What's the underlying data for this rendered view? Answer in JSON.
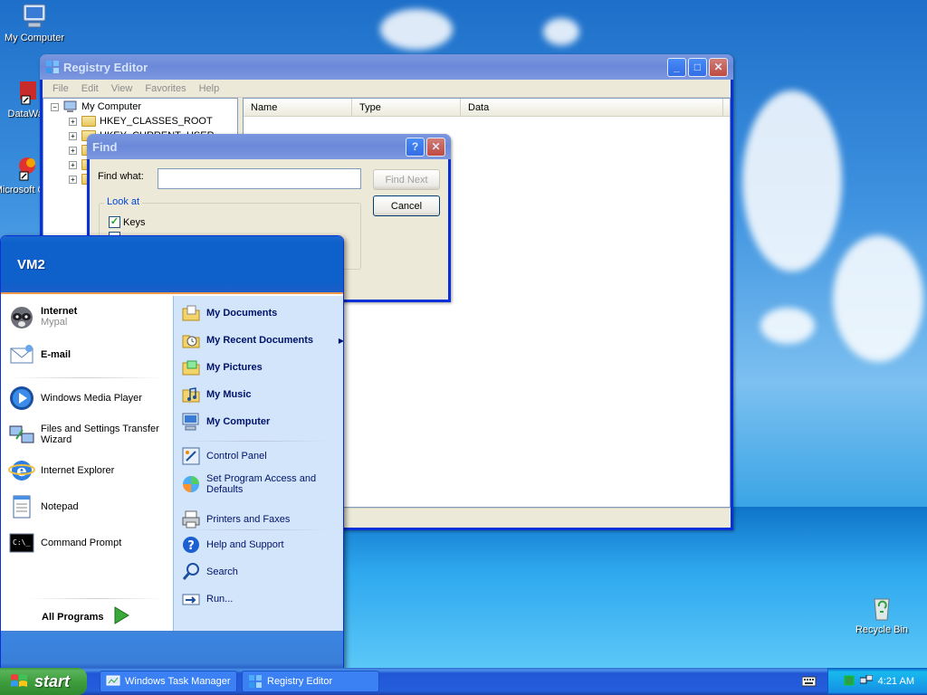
{
  "desktop": {
    "icons": [
      {
        "label": "My Computer"
      },
      {
        "label": "DataWar"
      },
      {
        "label": "Microsoft C++"
      },
      {
        "label": "Recycle Bin"
      }
    ]
  },
  "registry_editor": {
    "title": "Registry Editor",
    "menu": [
      "File",
      "Edit",
      "View",
      "Favorites",
      "Help"
    ],
    "tree_root": "My Computer",
    "tree_items": [
      "HKEY_CLASSES_ROOT",
      "HKEY_CURRENT_USER",
      "",
      "",
      ""
    ],
    "columns": [
      "Name",
      "Type",
      "Data"
    ]
  },
  "find_dialog": {
    "title": "Find",
    "find_what_label": "Find what:",
    "find_what_value": "",
    "find_next_label": "Find Next",
    "cancel_label": "Cancel",
    "look_at_label": "Look at",
    "keys_label": "Keys"
  },
  "start_menu": {
    "user_name": "VM2",
    "pinned": [
      {
        "title": "Internet",
        "subtitle": "Mypal"
      },
      {
        "title": "E-mail",
        "subtitle": ""
      }
    ],
    "recent": [
      "Windows Media Player",
      "Files and Settings Transfer Wizard",
      "Internet Explorer",
      "Notepad",
      "Command Prompt"
    ],
    "all_programs": "All Programs",
    "right_top": [
      "My Documents",
      "My Recent Documents",
      "My Pictures",
      "My Music",
      "My Computer"
    ],
    "right_mid": [
      "Control Panel",
      "Set Program Access and Defaults",
      "Printers and Faxes"
    ],
    "right_bottom": [
      "Help and Support",
      "Search",
      "Run..."
    ]
  },
  "taskbar": {
    "start_label": "start",
    "tasks": [
      "Windows Task Manager",
      "Registry Editor"
    ],
    "clock": "4:21 AM"
  }
}
